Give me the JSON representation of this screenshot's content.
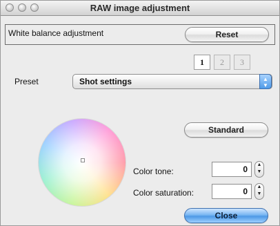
{
  "window": {
    "title": "RAW image adjustment"
  },
  "white_balance": {
    "label": "White balance adjustment",
    "reset_label": "Reset"
  },
  "tabs": [
    {
      "label": "1",
      "active": true
    },
    {
      "label": "2",
      "active": false
    },
    {
      "label": "3",
      "active": false
    }
  ],
  "preset": {
    "label": "Preset",
    "selected": "Shot settings"
  },
  "standard_label": "Standard",
  "color_tone": {
    "label": "Color tone:",
    "value": "0"
  },
  "color_saturation": {
    "label": "Color saturation:",
    "value": "0"
  },
  "close_label": "Close",
  "colors": {
    "accent": "#4d98e6",
    "window_bg": "#ececec"
  },
  "icons": {
    "window_controls": "traffic-light-icons",
    "select_arrows": "up-down-chevron-icon",
    "stepper": "stepper-arrows-icon"
  }
}
